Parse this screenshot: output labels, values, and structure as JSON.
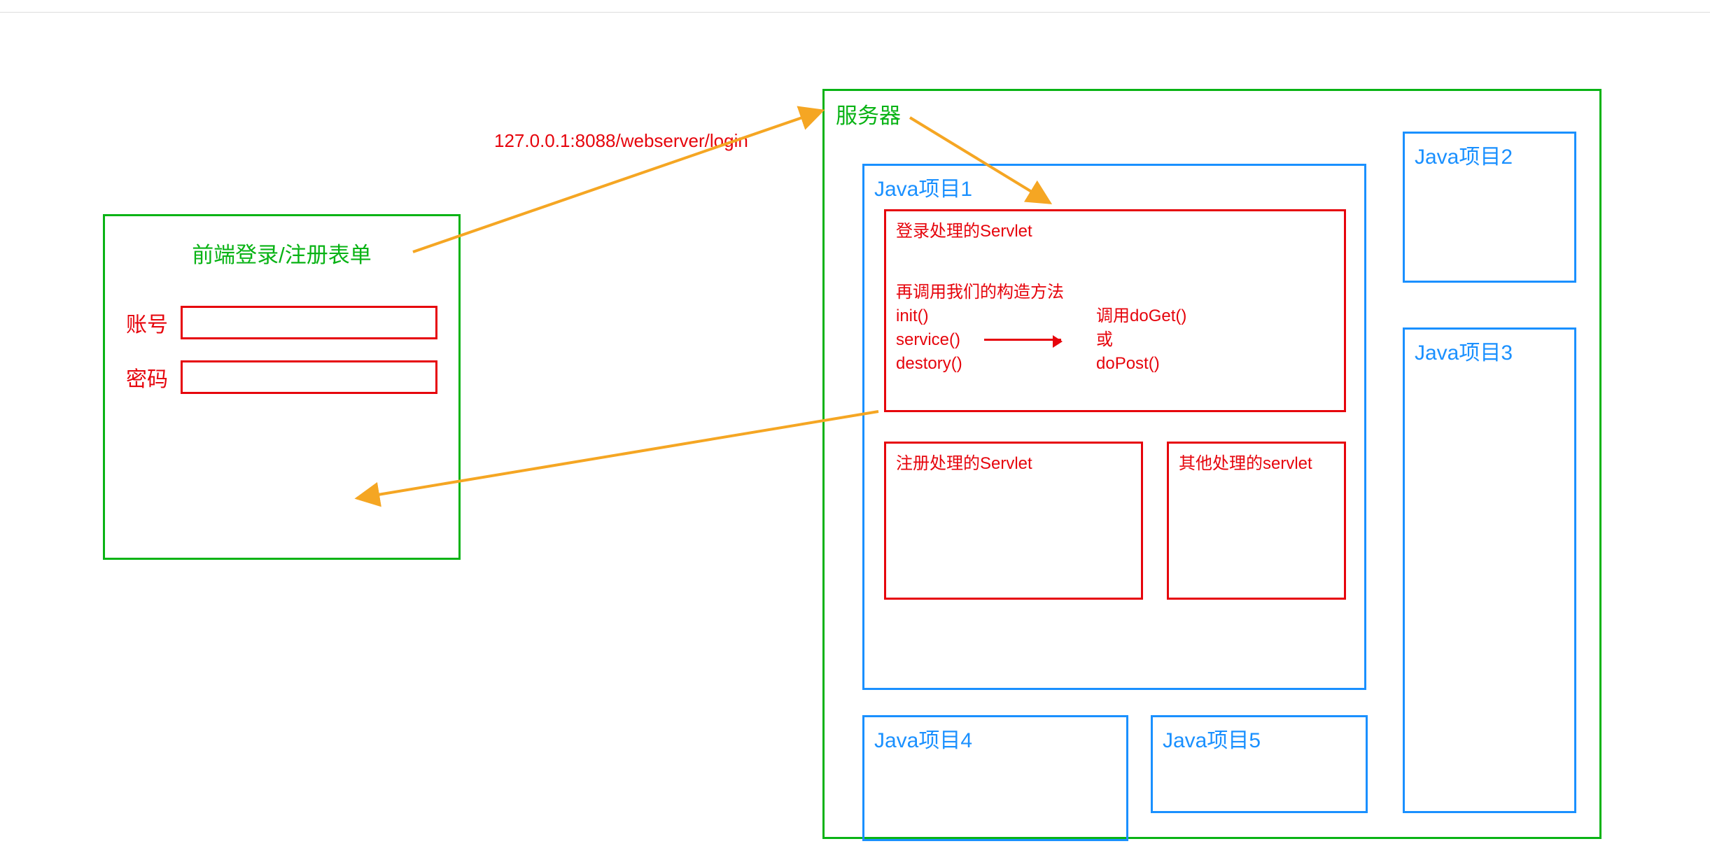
{
  "url_label": "127.0.0.1:8088/webserver/login",
  "client": {
    "title": "前端登录/注册表单",
    "account_label": "账号",
    "password_label": "密码"
  },
  "server": {
    "title": "服务器",
    "projects": {
      "p1": "Java项目1",
      "p2": "Java项目2",
      "p3": "Java项目3",
      "p4": "Java项目4",
      "p5": "Java项目5"
    },
    "servlets": {
      "login_title": "登录处理的Servlet",
      "register_title": "注册处理的Servlet",
      "other_title": "其他处理的servlet",
      "lifecycle_intro": "再调用我们的构造方法",
      "lifecycle_init": "init()",
      "lifecycle_service": "service()",
      "lifecycle_destory": "destory()",
      "dispatch_doget": "调用doGet()",
      "dispatch_or": "或",
      "dispatch_dopost": "doPost()"
    }
  }
}
